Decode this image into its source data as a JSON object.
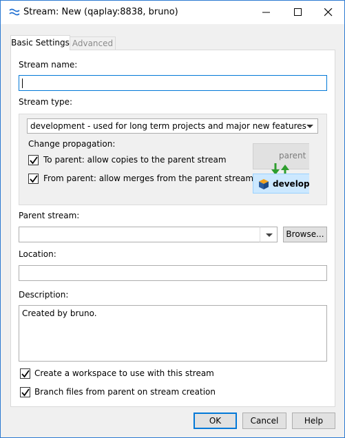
{
  "window": {
    "title": "Stream: New (qaplay:8838,  bruno)",
    "title_icon": "stream-icon",
    "controls": [
      "minimize-icon",
      "maximize-icon",
      "close-icon"
    ]
  },
  "tabs": [
    {
      "label": "Basic Settings",
      "active": true
    },
    {
      "label": "Advanced",
      "active": false
    }
  ],
  "form": {
    "stream_name": {
      "label": "Stream name:",
      "value": ""
    },
    "stream_type": {
      "label": "Stream type:",
      "selected": "development - used for long term projects and major new features"
    },
    "change_propagation": {
      "label": "Change propagation:",
      "to_parent": {
        "label": "To parent: allow copies to the parent stream",
        "checked": true
      },
      "from_parent": {
        "label": "From parent: allow merges from the parent stream",
        "checked": true
      },
      "diagram": {
        "parent_label": "parent",
        "child_label": "developr",
        "child_icon": "cube-icon",
        "arrows_icon": "merge-copy-arrows-icon"
      }
    },
    "parent_stream": {
      "label": "Parent stream:",
      "value": "",
      "browse_label": "Browse..."
    },
    "location": {
      "label": "Location:",
      "value": ""
    },
    "description": {
      "label": "Description:",
      "value": "Created by bruno."
    },
    "create_workspace": {
      "label": "Create a workspace to use with this stream",
      "checked": true
    },
    "branch_files": {
      "label": "Branch files from parent on stream creation",
      "checked": true
    }
  },
  "buttons": {
    "ok": "OK",
    "cancel": "Cancel",
    "help": "Help"
  },
  "colors": {
    "accent": "#0078d7",
    "arrow_green": "#2e9e2e",
    "child_highlight": "#cce8ff"
  }
}
